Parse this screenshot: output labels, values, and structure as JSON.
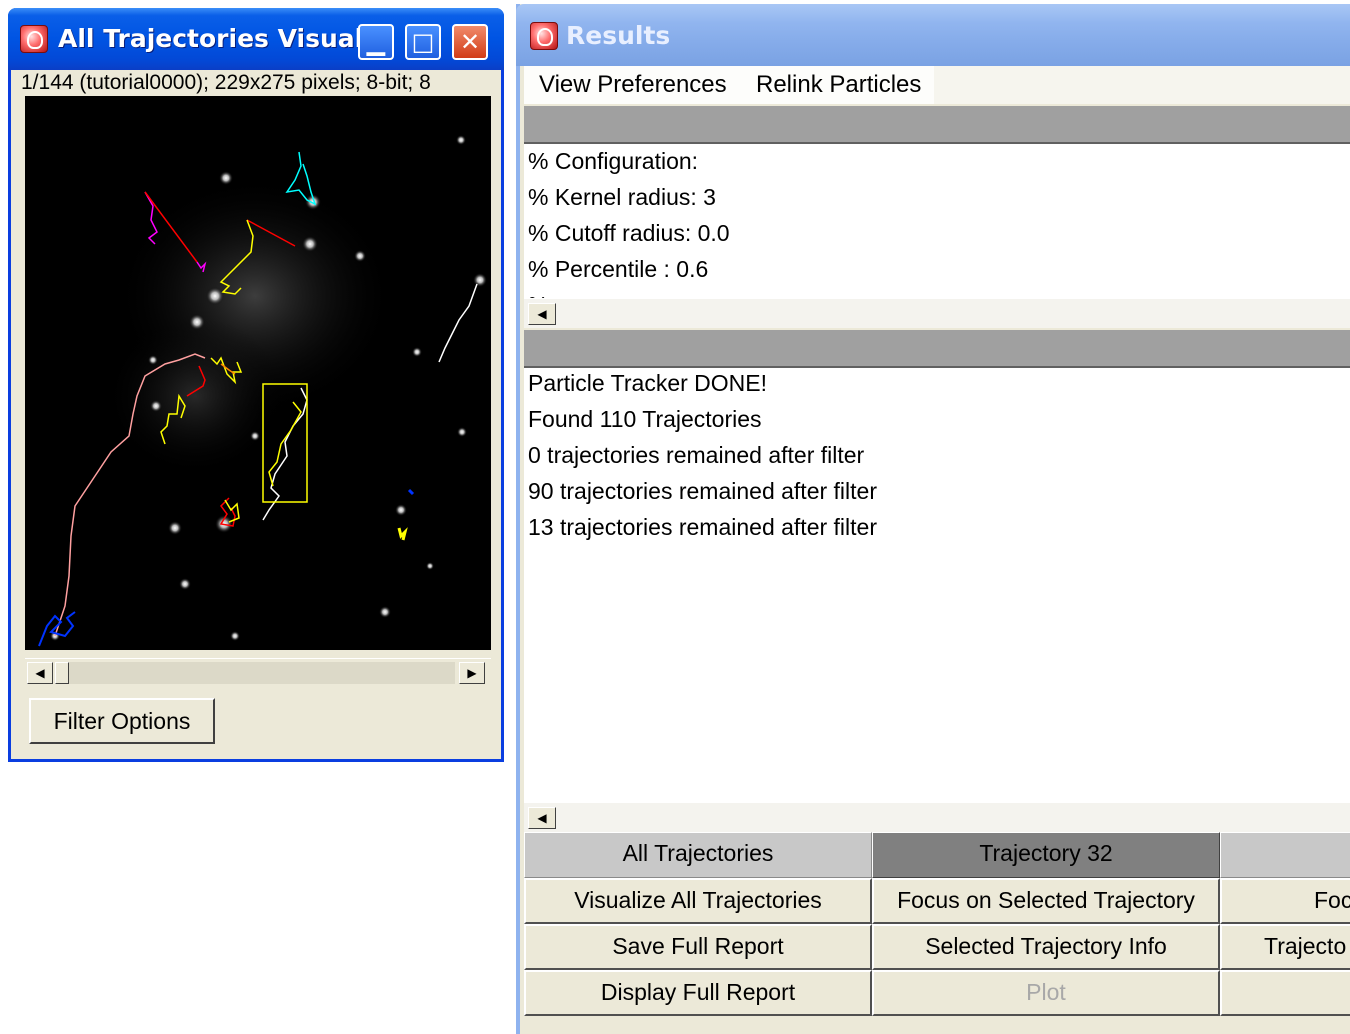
{
  "trajectory_window": {
    "title": "All Trajectories Visual",
    "info_line": "1/144 (tutorial0000); 229x275 pixels; 8-bit; 8",
    "filter_button": "Filter Options",
    "controls": {
      "minimize": "minimize-icon",
      "maximize": "maximize-icon",
      "close": "close-icon"
    },
    "trajectory_colors": [
      "#ff00ff",
      "#ff0000",
      "#ffff00",
      "#00ffff",
      "#ffffff",
      "#ffa0a0",
      "#0033ff",
      "#ff8800"
    ],
    "selection_box_color": "#ffff00",
    "horizontal_scroll_position": 0
  },
  "results_window": {
    "title": "Results",
    "menu": [
      "View Preferences",
      "Relink Particles"
    ],
    "config_lines": [
      "% Configuration:",
      "% Kernel radius: 3",
      "% Cutoff radius: 0.0",
      "% Percentile : 0.6"
    ],
    "output_lines": [
      "Particle Tracker DONE!",
      "Found 110 Trajectories",
      "0 trajectories remained after filter",
      "90 trajectories remained after filter",
      "13 trajectories remained after filter"
    ],
    "columns": {
      "all": {
        "header": "All Trajectories",
        "buttons": [
          "Visualize All Trajectories",
          "Save Full Report",
          "Display Full Report"
        ]
      },
      "selected": {
        "header": "Trajectory 32",
        "buttons": [
          "Focus on Selected Trajectory",
          "Selected Trajectory Info",
          "Plot"
        ]
      },
      "third": {
        "header": "",
        "buttons": [
          "Foc",
          "Trajecto",
          ""
        ]
      }
    }
  }
}
